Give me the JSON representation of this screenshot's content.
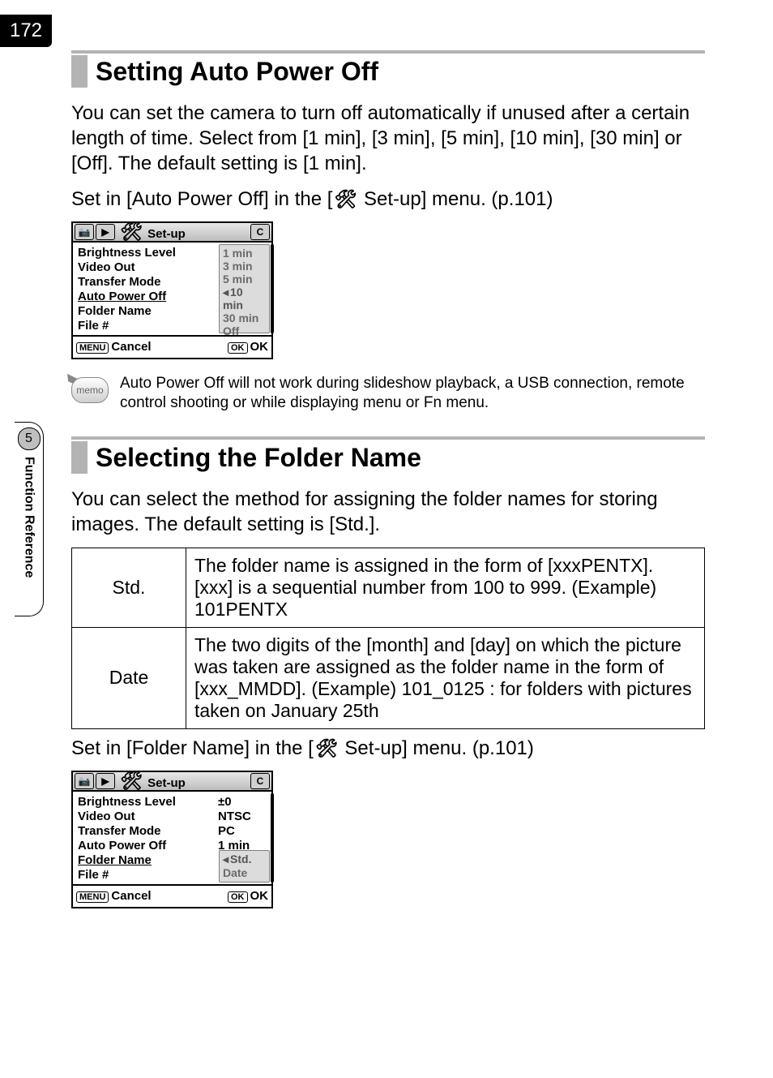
{
  "page_number": "172",
  "sidebar": {
    "chapter_number": "5",
    "chapter_label": "Function Reference"
  },
  "section1": {
    "heading": "Setting Auto Power Off",
    "para1": "You can set the camera to turn off automatically if unused after a certain length of time. Select from [1 min], [3 min], [5 min], [10 min], [30 min] or [Off]. The default setting is [1 min].",
    "para2_pre": "Set in [Auto Power Off] in the [",
    "para2_icon": "Set-up",
    "para2_post": " Set-up] menu. (p.101)",
    "memo": "Auto Power Off will not work during slideshow playback, a USB connection, remote control shooting or while displaying menu or Fn menu.",
    "memo_label": "memo"
  },
  "menu1": {
    "title": "Set-up",
    "corner_label": "C",
    "items": [
      {
        "label": "Brightness Level"
      },
      {
        "label": "Video Out"
      },
      {
        "label": "Transfer Mode"
      },
      {
        "label": "Auto Power Off",
        "highlight": true
      },
      {
        "label": "Folder Name"
      },
      {
        "label": "File #"
      }
    ],
    "options": [
      "1 min",
      "3 min",
      "5 min",
      "10 min",
      "30 min",
      "Off"
    ],
    "selected_option_index": 3,
    "footer": {
      "menu_key": "MENU",
      "menu_action": "Cancel",
      "ok_key": "OK",
      "ok_action": "OK"
    }
  },
  "section2": {
    "heading": "Selecting the Folder Name",
    "para1": "You can select the method for assigning the folder names for storing images. The default setting is [Std.].",
    "table": [
      {
        "name": "Std.",
        "desc": "The folder name is assigned in the form of [xxxPENTX]. [xxx] is a sequential number from 100 to 999. (Example) 101PENTX"
      },
      {
        "name": "Date",
        "desc": "The two digits of the [month] and [day] on which the picture was taken are assigned as the folder name in the form of [xxx_MMDD]. (Example) 101_0125 : for folders with pictures taken on January 25th"
      }
    ],
    "para2_pre": "Set in [Folder Name] in the [",
    "para2_post": " Set-up] menu. (p.101)"
  },
  "menu2": {
    "title": "Set-up",
    "corner_label": "C",
    "items": [
      {
        "label": "Brightness Level",
        "value": "±0"
      },
      {
        "label": "Video Out",
        "value": "NTSC"
      },
      {
        "label": "Transfer Mode",
        "value": "PC"
      },
      {
        "label": "Auto Power Off",
        "value": "1 min"
      },
      {
        "label": "Folder Name",
        "highlight": true
      },
      {
        "label": "File #"
      }
    ],
    "options": [
      "Std.",
      "Date"
    ],
    "selected_option_index": 0,
    "footer": {
      "menu_key": "MENU",
      "menu_action": "Cancel",
      "ok_key": "OK",
      "ok_action": "OK"
    }
  }
}
